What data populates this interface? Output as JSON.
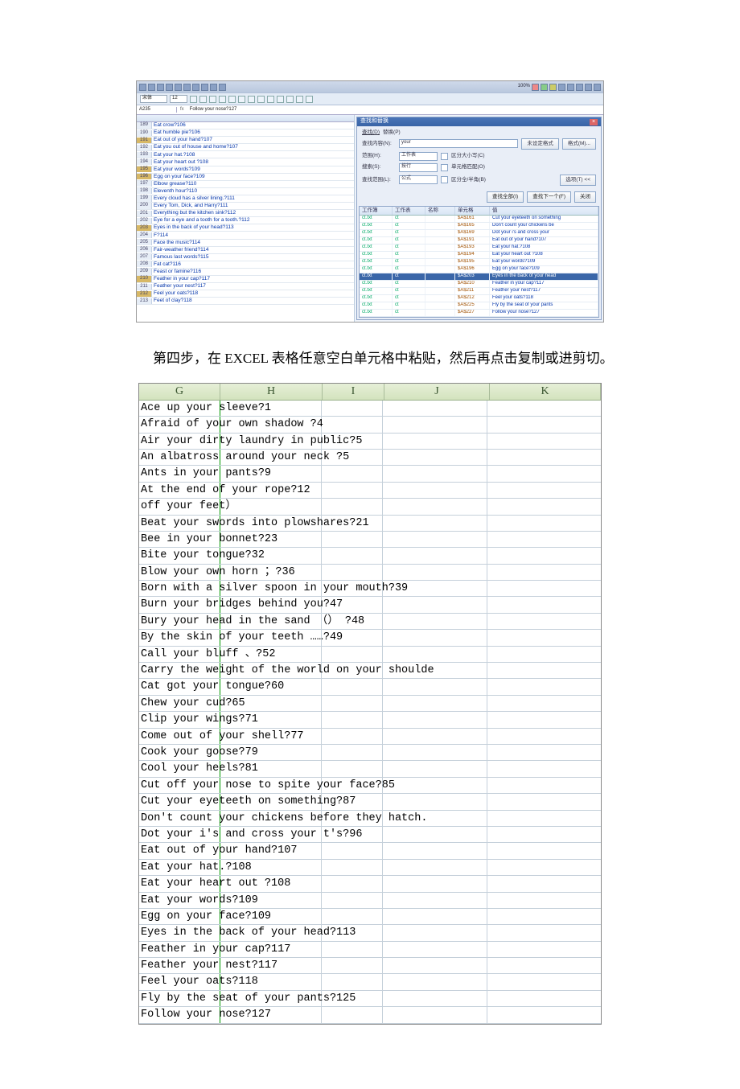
{
  "caption": "第四步，在 EXCEL 表格任意空白单元格中粘贴，然后再点击复制或进剪切。",
  "top": {
    "cellref": "A235",
    "fxlabel": "fx",
    "formula": "Follow your nose?127",
    "zoom": "100%",
    "fontbox": "宋体",
    "sizebox": "12",
    "rows": [
      {
        "n": "189",
        "t": "Eat crow?106",
        "hl": false
      },
      {
        "n": "190",
        "t": "Eat humble pie?106",
        "hl": false
      },
      {
        "n": "191",
        "t": "Eat out of your hand?107",
        "hl": true
      },
      {
        "n": "192",
        "t": "Eat you out of house and home?107",
        "hl": false
      },
      {
        "n": "193",
        "t": "Eat your hat.?108",
        "hl": false
      },
      {
        "n": "194",
        "t": "Eat your heart out ?108",
        "hl": false
      },
      {
        "n": "195",
        "t": "Eat your words?109",
        "hl": true
      },
      {
        "n": "196",
        "t": "Egg on your face?109",
        "hl": true
      },
      {
        "n": "197",
        "t": "Elbow grease?110",
        "hl": false
      },
      {
        "n": "198",
        "t": "Eleventh hour?110",
        "hl": false
      },
      {
        "n": "199",
        "t": "Every cloud has a silver lining.?111",
        "hl": false
      },
      {
        "n": "200",
        "t": "Every Tom, Dick, and Harry?111",
        "hl": false
      },
      {
        "n": "201",
        "t": "Everything but the kitchen sink?112",
        "hl": false
      },
      {
        "n": "202",
        "t": "Eye for a eye and a tooth for a tooth.?112",
        "hl": false
      },
      {
        "n": "203",
        "t": "Eyes in the back of your head?113",
        "hl": true
      },
      {
        "n": "204",
        "t": "F?114",
        "hl": false
      },
      {
        "n": "205",
        "t": "Face the music?114",
        "hl": false
      },
      {
        "n": "206",
        "t": "Fair-weather friend?114",
        "hl": false
      },
      {
        "n": "207",
        "t": "Famous last words?115",
        "hl": false
      },
      {
        "n": "208",
        "t": "Fat cat?116",
        "hl": false
      },
      {
        "n": "209",
        "t": "Feast or famine?116",
        "hl": false
      },
      {
        "n": "210",
        "t": "Feather in your cap?117",
        "hl": true
      },
      {
        "n": "211",
        "t": "Feather your nest?117",
        "hl": false
      },
      {
        "n": "212",
        "t": "Feel your oats?118",
        "hl": true
      },
      {
        "n": "213",
        "t": "Feet of clay?118",
        "hl": false
      }
    ],
    "find": {
      "title": "查找和替换",
      "tab_find": "查找(D)",
      "tab_replace": "替换(P)",
      "label_content": "查找内容(N):",
      "content_value": "your",
      "btn_fmt": "未设定格式",
      "btn_fmt2": "格式(M)...",
      "label_scope": "范围(H):",
      "scope_val": "工作表",
      "chk1": "区分大小写(C)",
      "chk2": "单元格匹配(O)",
      "chk3": "区分全/半角(B)",
      "label_search": "搜索(S):",
      "search_val": "按行",
      "label_lookin": "查找范围(L):",
      "lookin_val": "公式",
      "btn_options": "选项(T) <<",
      "btn_findall": "查找全部(I)",
      "btn_findnext": "查找下一个(F)",
      "btn_close": "关闭"
    },
    "results": {
      "hdr": [
        "工作簿",
        "工作表",
        "名称",
        "单元格",
        "值"
      ],
      "rows": [
        [
          "ct.txt",
          "ct",
          "",
          "$A$161",
          "Cut your eyeteeth on something"
        ],
        [
          "ct.txt",
          "ct",
          "",
          "$A$165",
          "Don't count your chickens be"
        ],
        [
          "ct.txt",
          "ct",
          "",
          "$A$169",
          "Dot your i's and cross your"
        ],
        [
          "ct.txt",
          "ct",
          "",
          "$A$191",
          "Eat out of your hand?107"
        ],
        [
          "ct.txt",
          "ct",
          "",
          "$A$193",
          "Eat your hat.?108"
        ],
        [
          "ct.txt",
          "ct",
          "",
          "$A$194",
          "Eat your heart out ?108"
        ],
        [
          "ct.txt",
          "ct",
          "",
          "$A$195",
          "Eat your words?109"
        ],
        [
          "ct.txt",
          "ct",
          "",
          "$A$196",
          "Egg on your face?109"
        ],
        [
          "ct.txt",
          "ct",
          "",
          "$A$203",
          "Eyes in the back of your head"
        ],
        [
          "ct.txt",
          "ct",
          "",
          "$A$210",
          "Feather in your cap?117"
        ],
        [
          "ct.txt",
          "ct",
          "",
          "$A$211",
          "Feather your nest?117"
        ],
        [
          "ct.txt",
          "ct",
          "",
          "$A$212",
          "Feel your oats?118"
        ],
        [
          "ct.txt",
          "ct",
          "",
          "$A$225",
          "Fly by the seat of your pants"
        ],
        [
          "ct.txt",
          "ct",
          "",
          "$A$227",
          "Follow your nose?127"
        ]
      ],
      "selrow": 8
    }
  },
  "grid": {
    "cols": [
      "G",
      "H",
      "I",
      "J",
      "K"
    ],
    "rows": [
      "Ace up your sleeve?1",
      "Afraid of your own shadow ?4",
      "Air your dirty laundry in public?5",
      "An albatross around your neck ?5",
      "Ants in your pants?9",
      "At the end of your rope?12",
      "    off your feet）",
      "Beat your swords into plowshares?21",
      "Bee in your bonnet?23",
      "Bite your tongue?32",
      "Blow your own horn ；?36",
      "Born with a silver spoon in your mouth?39",
      "Burn your bridges behind you?47",
      "Bury your head in the sand （） ?48",
      "By the skin of your teeth ……?49",
      "Call your bluff 、?52",
      "Carry the weight of the world on your shoulde",
      "Cat got your tongue?60",
      "Chew your cud?65",
      "Clip your wings?71",
      "Come out of your shell?77",
      "Cook your goose?79",
      "Cool your heels?81",
      "Cut off your nose to spite your face?85",
      "Cut your eyeteeth on something?87",
      "Don't count your chickens before they hatch.",
      "Dot your i's and cross your t's?96",
      "Eat out of your hand?107",
      "Eat your hat.?108",
      "Eat your heart out ?108",
      "Eat your words?109",
      "Egg on your face?109",
      "Eyes in the back of your head?113",
      "Feather in your cap?117",
      "Feather your nest?117",
      "Feel your oats?118",
      "Fly by the seat of your pants?125",
      "Follow your nose?127"
    ]
  }
}
